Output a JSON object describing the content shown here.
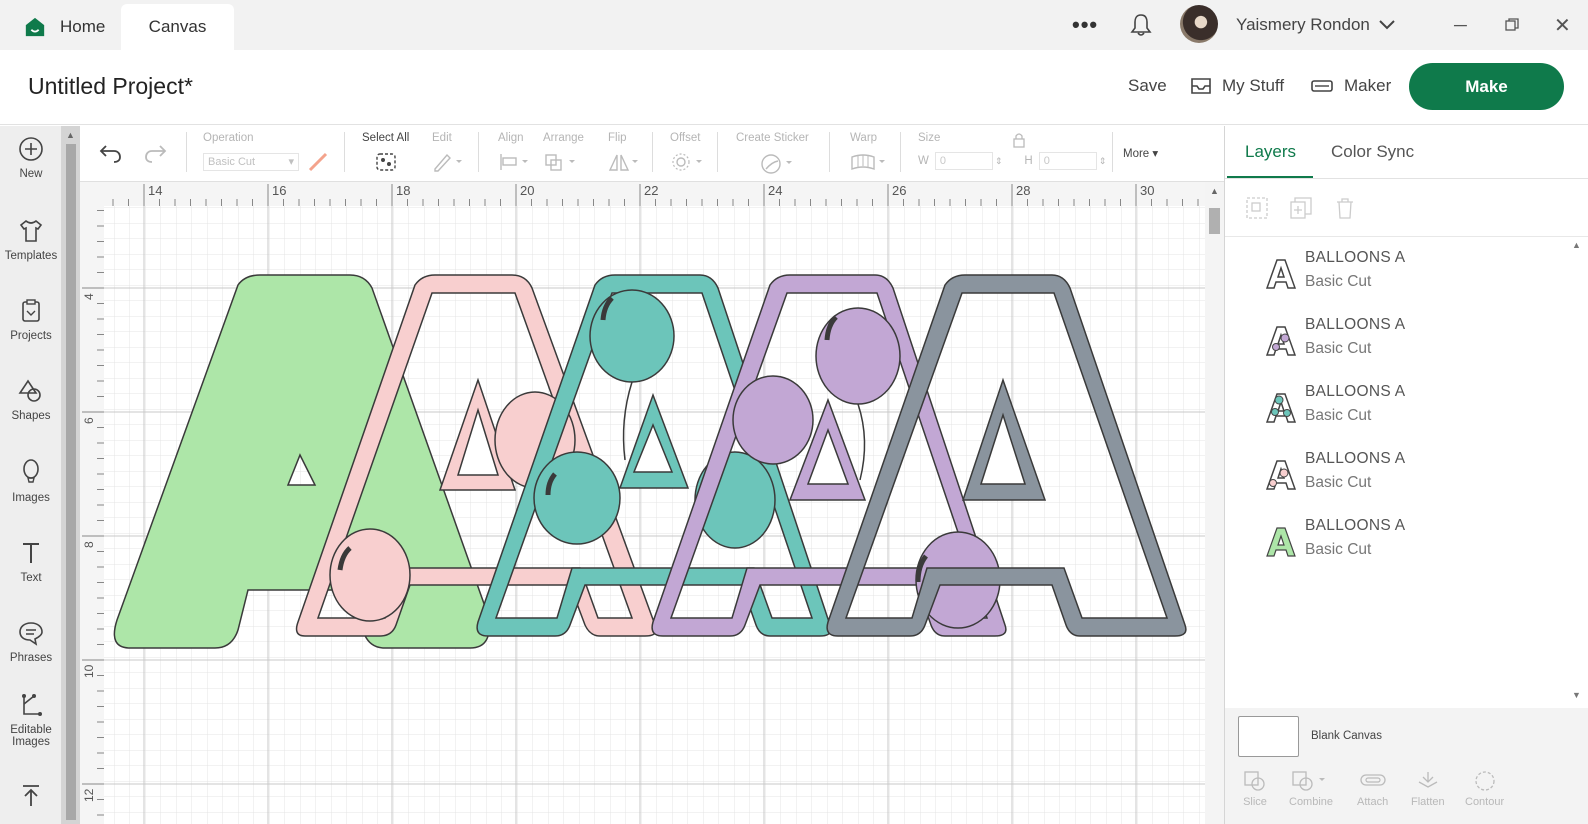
{
  "titlebar": {
    "home_tab": "Home",
    "canvas_tab": "Canvas",
    "more_glyph": "•••",
    "user_name": "Yaismery Rondon",
    "minimize_glyph": "─",
    "close_glyph": "✕"
  },
  "header": {
    "project_title": "Untitled Project*",
    "save_label": "Save",
    "mystuff_label": "My Stuff",
    "maker_label": "Maker",
    "make_label": "Make"
  },
  "sidebar": {
    "items": [
      {
        "label": "New",
        "icon": "plus-circle-icon"
      },
      {
        "label": "Templates",
        "icon": "shirt-icon"
      },
      {
        "label": "Projects",
        "icon": "projects-icon"
      },
      {
        "label": "Shapes",
        "icon": "shapes-icon"
      },
      {
        "label": "Images",
        "icon": "balloon-icon"
      },
      {
        "label": "Text",
        "icon": "text-icon"
      },
      {
        "label": "Phrases",
        "icon": "speech-bubble-icon"
      },
      {
        "label": "Editable\nImages",
        "label_line1": "Editable",
        "label_line2": "Images",
        "icon": "editable-images-icon"
      },
      {
        "label": "",
        "icon": "upload-icon"
      }
    ]
  },
  "toolbar": {
    "operation_label": "Operation",
    "operation_value": "Basic Cut",
    "select_all_label": "Select All",
    "edit_label": "Edit",
    "align_label": "Align",
    "arrange_label": "Arrange",
    "flip_label": "Flip",
    "offset_label": "Offset",
    "create_sticker_label": "Create Sticker",
    "warp_label": "Warp",
    "size_label": "Size",
    "w_label": "W",
    "w_value": "0",
    "h_label": "H",
    "h_value": "0",
    "more_label": "More ▾"
  },
  "canvas": {
    "ruler_x": [
      "14",
      "16",
      "18",
      "20",
      "22",
      "24",
      "26",
      "28",
      "30"
    ],
    "ruler_y": [
      "4",
      "6",
      "8",
      "10",
      "12"
    ],
    "letters": [
      {
        "fill": "#ade6a8"
      },
      {
        "fill": "#f8cfcf"
      },
      {
        "fill": "#6cc5ba"
      },
      {
        "fill": "#c2a7d4"
      },
      {
        "fill": "#8a949e"
      }
    ]
  },
  "right_panel": {
    "tabs": [
      "Layers",
      "Color Sync"
    ],
    "layers": [
      {
        "name": "BALLOONS A",
        "operation": "Basic Cut",
        "color": "#8a949e"
      },
      {
        "name": "BALLOONS A",
        "operation": "Basic Cut",
        "color": "#c2a7d4"
      },
      {
        "name": "BALLOONS A",
        "operation": "Basic Cut",
        "color": "#6cc5ba"
      },
      {
        "name": "BALLOONS A",
        "operation": "Basic Cut",
        "color": "#f8cfcf"
      },
      {
        "name": "BALLOONS A",
        "operation": "Basic Cut",
        "color": "#ade6a8"
      }
    ],
    "blank_canvas_label": "Blank Canvas",
    "bottom_tools": [
      "Slice",
      "Combine",
      "Attach",
      "Flatten",
      "Contour"
    ]
  },
  "colors": {
    "accent": "#0f7a4b",
    "sidebar_bg": "#eeeeee",
    "titlebar_bg": "#f2f2f2"
  }
}
